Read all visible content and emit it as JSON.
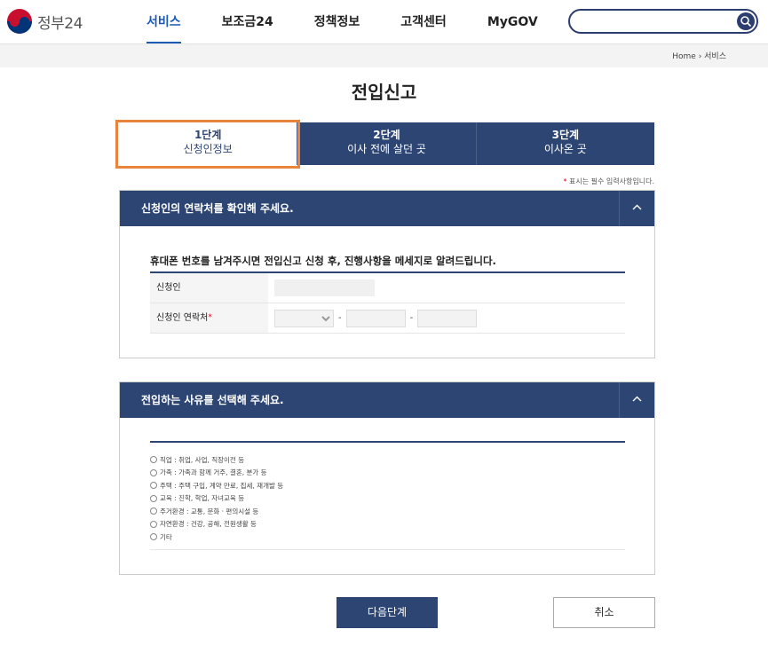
{
  "header": {
    "logo_text": "정부24",
    "nav": [
      {
        "label": "서비스",
        "active": true
      },
      {
        "label": "보조금24",
        "active": false
      },
      {
        "label": "정책정보",
        "active": false
      },
      {
        "label": "고객센터",
        "active": false
      },
      {
        "label": "MyGOV",
        "active": false
      }
    ],
    "search_icon": "search-icon"
  },
  "breadcrumb": {
    "home": "Home",
    "current": "서비스"
  },
  "page_title": "전입신고",
  "steps": [
    {
      "num": "1단계",
      "label": "신청인정보",
      "active": true
    },
    {
      "num": "2단계",
      "label": "이사 전에 살던 곳",
      "active": false
    },
    {
      "num": "3단계",
      "label": "이사온 곳",
      "active": false
    }
  ],
  "required_note": "표시는 필수 입력사항입니다.",
  "contact_panel": {
    "title": "신청인의 연락처를 확인해 주세요.",
    "info": "휴대폰 번호를 남겨주시면 전입신고 신청 후, 진행사항을 메세지로 알려드립니다.",
    "applicant_label": "신청인",
    "phone_label": "신청인 연락처",
    "dash": "-"
  },
  "reason_panel": {
    "title": "전입하는 사유를 선택해 주세요.",
    "options": [
      "직업 : 취업, 사업, 직장이전 등",
      "가족 : 가족과 함께 거주, 결혼, 분가 등",
      "주택 : 주택 구입, 계약 만료, 집세, 재개발 등",
      "교육 : 진학, 학업, 자녀교육 등",
      "주거환경 : 교통, 문화 · 편의시설 등",
      "자연환경 : 건강, 공해, 전원생활 등",
      "기타"
    ]
  },
  "buttons": {
    "next": "다음단계",
    "cancel": "취소"
  },
  "colors": {
    "primary": "#2d4573",
    "nav_active": "#1c5bb5",
    "highlight": "#e8843c",
    "required": "#d4001a"
  }
}
